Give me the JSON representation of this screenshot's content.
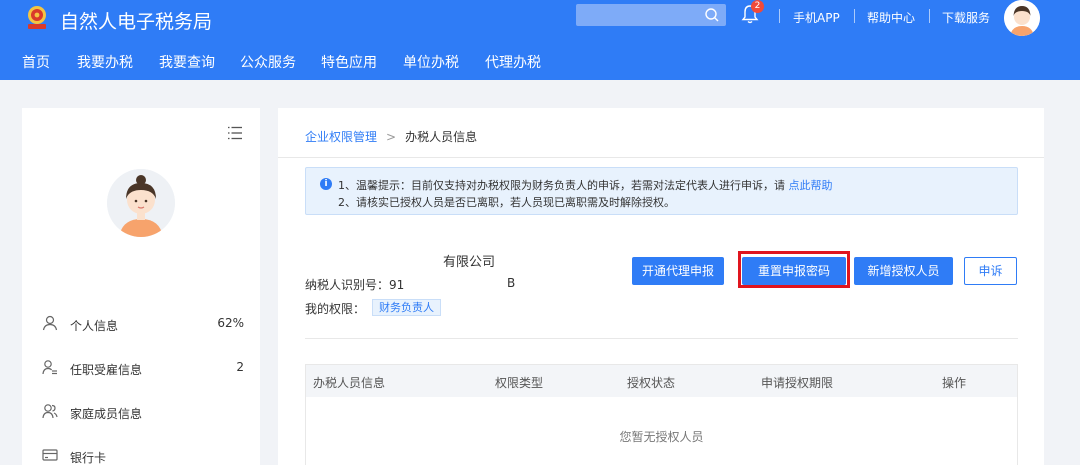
{
  "header": {
    "brand": "自然人电子税务局",
    "notification_count": "2",
    "links": [
      "手机APP",
      "帮助中心",
      "下载服务"
    ]
  },
  "nav": [
    "首页",
    "我要办税",
    "我要查询",
    "公众服务",
    "特色应用",
    "单位办税",
    "代理办税"
  ],
  "sidebar": {
    "items": [
      {
        "label": "个人信息",
        "value": "62%",
        "icon": "user-icon"
      },
      {
        "label": "任职受雇信息",
        "value": "2",
        "icon": "employment-icon"
      },
      {
        "label": "家庭成员信息",
        "value": "",
        "icon": "family-icon"
      },
      {
        "label": "银行卡",
        "value": "",
        "icon": "bank-card-icon"
      }
    ]
  },
  "main": {
    "breadcrumb": {
      "parent": "企业权限管理",
      "separator": ">",
      "current": "办税人员信息"
    },
    "tip": {
      "line1_text": "1、温馨提示：目前仅支持对办税权限为财务负责人的申诉，若需对法定代表人进行申诉，请",
      "line1_link": "点此帮助",
      "line2_text": "2、请核实已授权人员是否已离职，若人员现已离职需及时解除授权。"
    },
    "company_name": "有限公司",
    "taxid_label": "纳税人识别号：91",
    "taxid_suffix": "B",
    "permission_label": "我的权限：",
    "permission_value": "财务负责人",
    "buttons": {
      "agent": "开通代理申报",
      "reset": "重置申报密码",
      "add": "新增授权人员",
      "appeal": "申诉"
    },
    "table": {
      "headers": [
        "办税人员信息",
        "权限类型",
        "授权状态",
        "申请授权期限",
        "操作"
      ],
      "empty_text": "您暂无授权人员"
    }
  },
  "colors": {
    "primary": "#2f7cf6",
    "highlight": "#e0151e",
    "badge": "#f04a3a"
  }
}
